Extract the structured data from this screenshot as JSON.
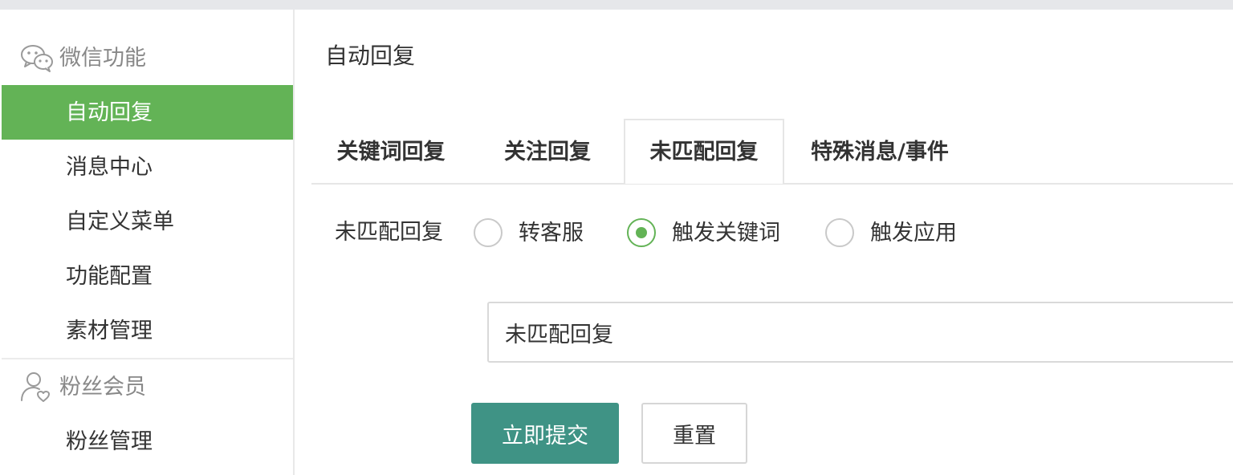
{
  "sidebar": {
    "groups": [
      {
        "label": "微信功能",
        "icon": "wechat-icon",
        "items": [
          {
            "label": "自动回复",
            "active": true
          },
          {
            "label": "消息中心"
          },
          {
            "label": "自定义菜单"
          },
          {
            "label": "功能配置"
          },
          {
            "label": "素材管理"
          }
        ]
      },
      {
        "label": "粉丝会员",
        "icon": "fan-user-icon",
        "items": [
          {
            "label": "粉丝管理"
          }
        ]
      }
    ]
  },
  "main": {
    "title": "自动回复",
    "tabs": [
      {
        "label": "关键词回复"
      },
      {
        "label": "关注回复"
      },
      {
        "label": "未匹配回复",
        "active": true
      },
      {
        "label": "特殊消息/事件"
      }
    ],
    "form": {
      "label": "未匹配回复",
      "radios": [
        {
          "label": "转客服",
          "checked": false
        },
        {
          "label": "触发关键词",
          "checked": true
        },
        {
          "label": "触发应用",
          "checked": false
        }
      ],
      "input_value": "未匹配回复",
      "submit_label": "立即提交",
      "reset_label": "重置"
    }
  },
  "colors": {
    "accent_green": "#63b356",
    "primary_button": "#3f9385"
  }
}
